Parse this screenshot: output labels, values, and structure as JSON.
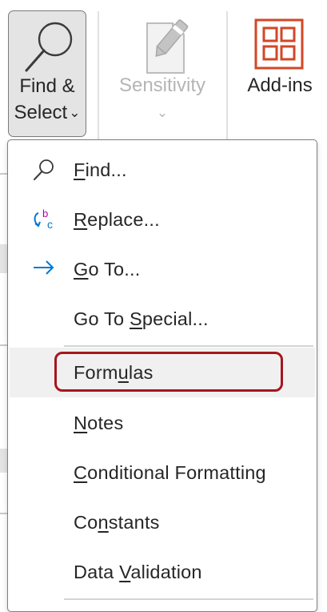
{
  "ribbon": {
    "find_select": {
      "line1": "Find &",
      "line2": "Select",
      "chevron": "⌄",
      "icon": "magnifier-icon"
    },
    "sensitivity": {
      "label": "Sensitivity",
      "chevron": "⌄",
      "icon": "sensitivity-label-icon"
    },
    "addins": {
      "label": "Add-ins",
      "icon": "addins-grid-icon",
      "color": "#d24726"
    }
  },
  "menu": {
    "items": [
      {
        "pre": "",
        "ul": "F",
        "post": "ind...",
        "icon": "search-icon"
      },
      {
        "pre": "",
        "ul": "R",
        "post": "eplace...",
        "icon": "replace-icon"
      },
      {
        "pre": "",
        "ul": "G",
        "post": "o To...",
        "icon": "arrow-right-icon"
      },
      {
        "pre": "Go To ",
        "ul": "S",
        "post": "pecial...",
        "icon": ""
      },
      {
        "pre": "Form",
        "ul": "u",
        "post": "las",
        "icon": ""
      },
      {
        "pre": "",
        "ul": "N",
        "post": "otes",
        "icon": ""
      },
      {
        "pre": "",
        "ul": "C",
        "post": "onditional Formatting",
        "icon": ""
      },
      {
        "pre": "Co",
        "ul": "n",
        "post": "stants",
        "icon": ""
      },
      {
        "pre": "Data ",
        "ul": "V",
        "post": "alidation",
        "icon": ""
      }
    ],
    "highlighted_item": "Formulas",
    "highlight_color": "#a4161f",
    "icon_accent": "#0078d4",
    "replace_icon_colors": [
      "#0078d4",
      "#b4009e"
    ]
  }
}
